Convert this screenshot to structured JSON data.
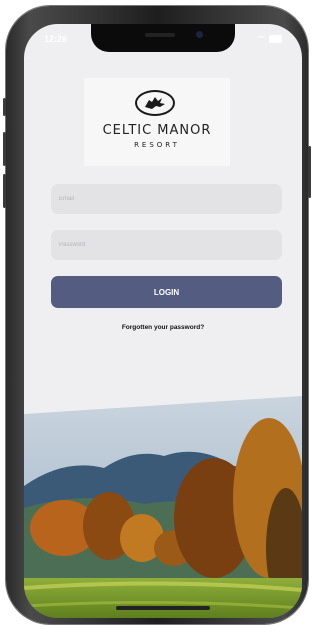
{
  "status_bar": {
    "time": "12:26"
  },
  "logo": {
    "name": "CELTIC MANOR",
    "sub": "RESORT"
  },
  "form": {
    "email_placeholder": "Email",
    "password_placeholder": "Password",
    "login_label": "LOGIN",
    "forgot_label": "Forgotten your password?"
  },
  "colors": {
    "button": "#555c82",
    "field": "#e3e3e6",
    "background": "#efeff1"
  },
  "icons": [
    "wifi-icon",
    "battery-icon",
    "dragon-logo-icon"
  ]
}
